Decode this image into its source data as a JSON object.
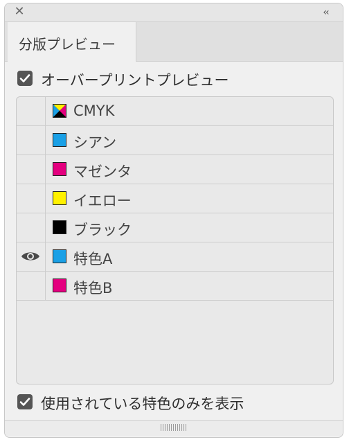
{
  "panel": {
    "tab_label": "分版プレビュー",
    "collapse_glyph": "‹‹",
    "close_glyph": "✕"
  },
  "overprint": {
    "label": "オーバープリントプレビュー",
    "checked": true
  },
  "separations": [
    {
      "name": "CMYK",
      "swatch": "cmyk",
      "visible": false
    },
    {
      "name": "シアン",
      "swatch": "#1aa0e6",
      "visible": false
    },
    {
      "name": "マゼンタ",
      "swatch": "#e4007f",
      "visible": false
    },
    {
      "name": "イエロー",
      "swatch": "#fff100",
      "visible": false
    },
    {
      "name": "ブラック",
      "swatch": "#000000",
      "visible": false
    },
    {
      "name": "特色A",
      "swatch": "#1aa0e6",
      "visible": true
    },
    {
      "name": "特色B",
      "swatch": "#e4007f",
      "visible": false
    }
  ],
  "spot_only": {
    "label": "使用されている特色のみを表示",
    "checked": true
  },
  "icons": {
    "visibility": "eye-icon",
    "close": "close-icon",
    "collapse": "collapse-icon",
    "check": "check-icon"
  }
}
